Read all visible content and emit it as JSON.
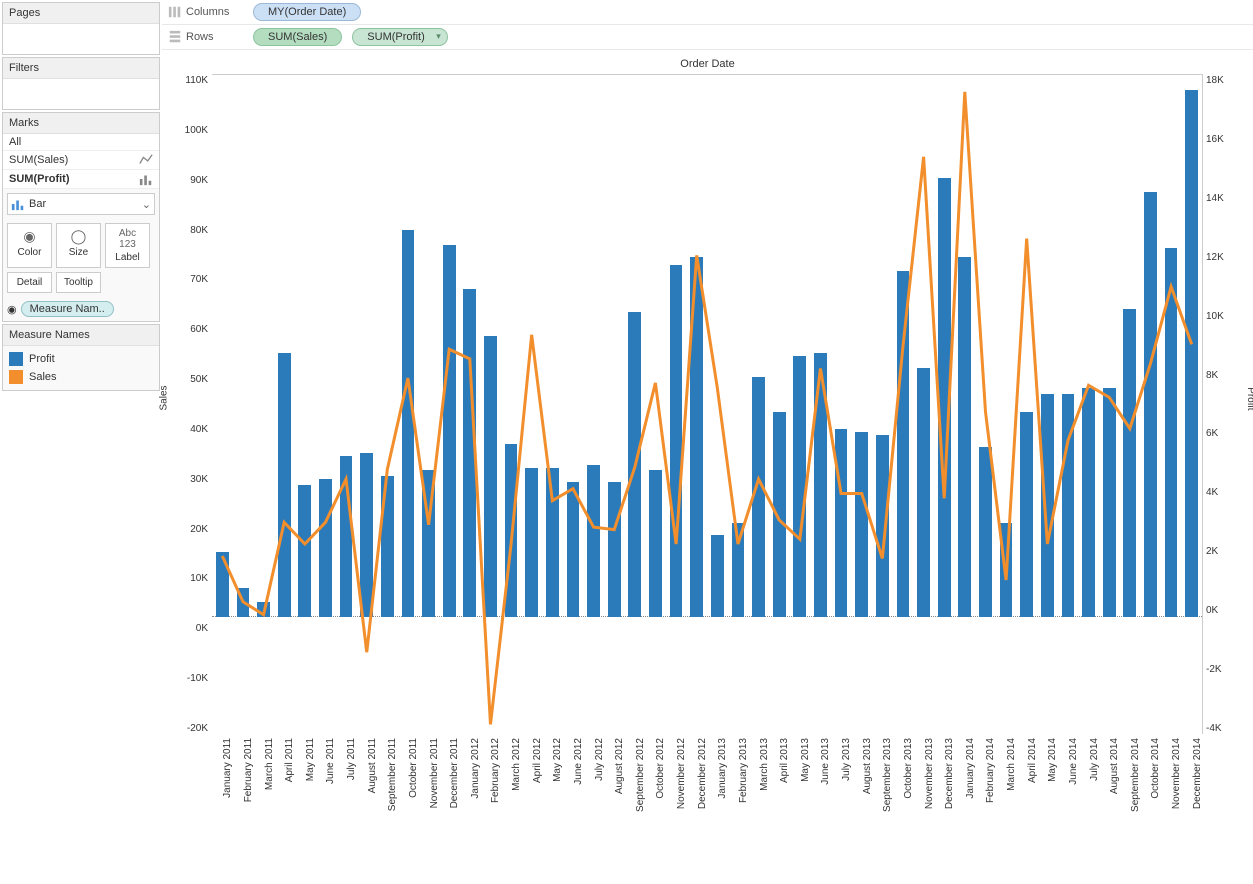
{
  "sidebar": {
    "pages_label": "Pages",
    "filters_label": "Filters",
    "marks_label": "Marks",
    "marks_all": "All",
    "marks_sum_sales": "SUM(Sales)",
    "marks_sum_profit": "SUM(Profit)",
    "mark_type": "Bar",
    "cards": {
      "color": "Color",
      "size": "Size",
      "label": "Label",
      "detail": "Detail",
      "tooltip": "Tooltip"
    },
    "measure_pill": "Measure Nam..",
    "legend_title": "Measure Names",
    "legend_profit": "Profit",
    "legend_sales": "Sales"
  },
  "shelves": {
    "columns_label": "Columns",
    "rows_label": "Rows",
    "columns_pill": "MY(Order Date)",
    "rows_pill1": "SUM(Sales)",
    "rows_pill2": "SUM(Profit)"
  },
  "chart_title": "Order Date",
  "axis_left_label": "Sales",
  "axis_right_label": "Profit",
  "left_ticks": [
    "110K",
    "100K",
    "90K",
    "80K",
    "70K",
    "60K",
    "50K",
    "40K",
    "30K",
    "20K",
    "10K",
    "0K",
    "-10K",
    "-20K"
  ],
  "right_ticks": [
    "18K",
    "16K",
    "14K",
    "12K",
    "10K",
    "8K",
    "6K",
    "4K",
    "2K",
    "0K",
    "-2K",
    "-4K"
  ],
  "chart_data": {
    "type": "bar+line",
    "title": "Order Date",
    "left_axis": {
      "label": "Sales",
      "min": -22000,
      "max": 115000
    },
    "right_axis": {
      "label": "Profit",
      "min": -4000,
      "max": 18500
    },
    "categories": [
      "January 2011",
      "February 2011",
      "March 2011",
      "April 2011",
      "May 2011",
      "June 2011",
      "July 2011",
      "August 2011",
      "September 2011",
      "October 2011",
      "November 2011",
      "December 2011",
      "January 2012",
      "February 2012",
      "March 2012",
      "April 2012",
      "May 2012",
      "June 2012",
      "July 2012",
      "August 2012",
      "September 2012",
      "October 2012",
      "November 2012",
      "December 2012",
      "January 2013",
      "February 2013",
      "March 2013",
      "April 2013",
      "May 2013",
      "June 2013",
      "July 2013",
      "August 2013",
      "September 2013",
      "October 2013",
      "November 2013",
      "December 2013",
      "January 2014",
      "February 2014",
      "March 2014",
      "April 2014",
      "May 2014",
      "June 2014",
      "July 2014",
      "August 2014",
      "September 2014",
      "October 2014",
      "November 2014",
      "December 2014"
    ],
    "series": [
      {
        "name": "Sales",
        "type": "line",
        "axis": "left",
        "color": "#f28e2b",
        "values": [
          15000,
          5500,
          2800,
          22000,
          17500,
          22000,
          31000,
          -5000,
          33000,
          52000,
          21500,
          58000,
          56000,
          -20000,
          17500,
          61000,
          26500,
          29000,
          21000,
          20500,
          33500,
          51000,
          17500,
          77500,
          50000,
          17500,
          31000,
          22500,
          18500,
          54000,
          28000,
          28000,
          14500,
          58500,
          98000,
          27000,
          111500,
          45000,
          10000,
          81000,
          17500,
          39000,
          50500,
          48000,
          41500,
          55000,
          71000,
          59000
        ]
      },
      {
        "name": "Profit",
        "type": "bar",
        "axis": "right",
        "color": "#2b7bba",
        "values": [
          2200,
          1000,
          500,
          9000,
          4500,
          4700,
          5500,
          5600,
          4800,
          13200,
          5000,
          12700,
          11200,
          9600,
          5900,
          5100,
          5100,
          4600,
          5200,
          4600,
          10400,
          5000,
          12000,
          12300,
          2800,
          3200,
          8200,
          7000,
          8900,
          9000,
          6400,
          6300,
          6200,
          11800,
          8500,
          15000,
          12300,
          5800,
          3200,
          7000,
          7600,
          7600,
          7800,
          7800,
          10500,
          14500,
          12600,
          18000
        ]
      }
    ]
  }
}
